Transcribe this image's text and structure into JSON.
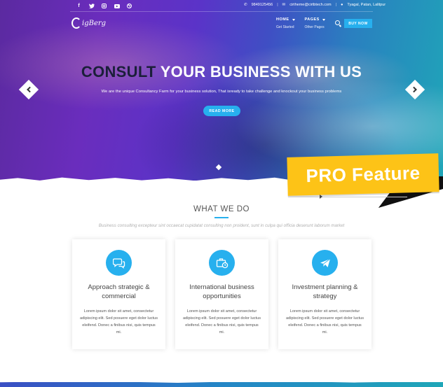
{
  "topbar": {
    "social_icons": [
      "facebook-icon",
      "twitter-icon",
      "instagram-icon",
      "youtube-icon",
      "dribbble-icon"
    ],
    "phone": "9849125456",
    "email": "cirtheme@cirtbtech.com",
    "location": "Tyagal, Patan, Lalitpur"
  },
  "logo": {
    "text": "igBerg"
  },
  "nav": {
    "items": [
      {
        "label": "HOME",
        "sub": "Get Started"
      },
      {
        "label": "PAGES",
        "sub": "Other Pages"
      }
    ],
    "buy_label": "BUY NOW"
  },
  "hero": {
    "headline_accent": "CONSULT",
    "headline_rest": "YOUR BUSINESS WITH US",
    "subline": "We are the unique Consultancy Farm for your business solution, That isready to take challenge and knockout your business problems",
    "button_label": "READ MORE"
  },
  "ribbon": {
    "label": "PRO Feature"
  },
  "section": {
    "title": "WHAT WE DO",
    "subtitle": "Business consulting excepteur sint occaecat cupidatat consulting non proident, sunt in culpa qui officia deserunt laborum market"
  },
  "cards": [
    {
      "icon": "chat-bubbles-icon",
      "title": "Approach strategic & commercial",
      "body": "Lorem ipsum dolor sit amet, consectetur adipiscing elit. Sed posuere eget dolor luctus eleifend. Donec a finibus nisi, quis tempus mi."
    },
    {
      "icon": "briefcase-clock-icon",
      "title": "International business opportunities",
      "body": "Lorem ipsum dolor sit amet, consectetur adipiscing elit. Sed posuere eget dolor luctus eleifend. Donec a finibus nisi, quis tempus mi."
    },
    {
      "icon": "paper-plane-icon",
      "title": "Investment planning & strategy",
      "body": "Lorem ipsum dolor sit amet, consectetur adipiscing elit. Sed posuere eget dolor luctus eleifend. Donec a finibus nisi, quis tempus mi."
    }
  ],
  "colors": {
    "accent": "#27b0ee",
    "ribbon": "#fdc317",
    "headline_dark": "#1b1f3a"
  }
}
